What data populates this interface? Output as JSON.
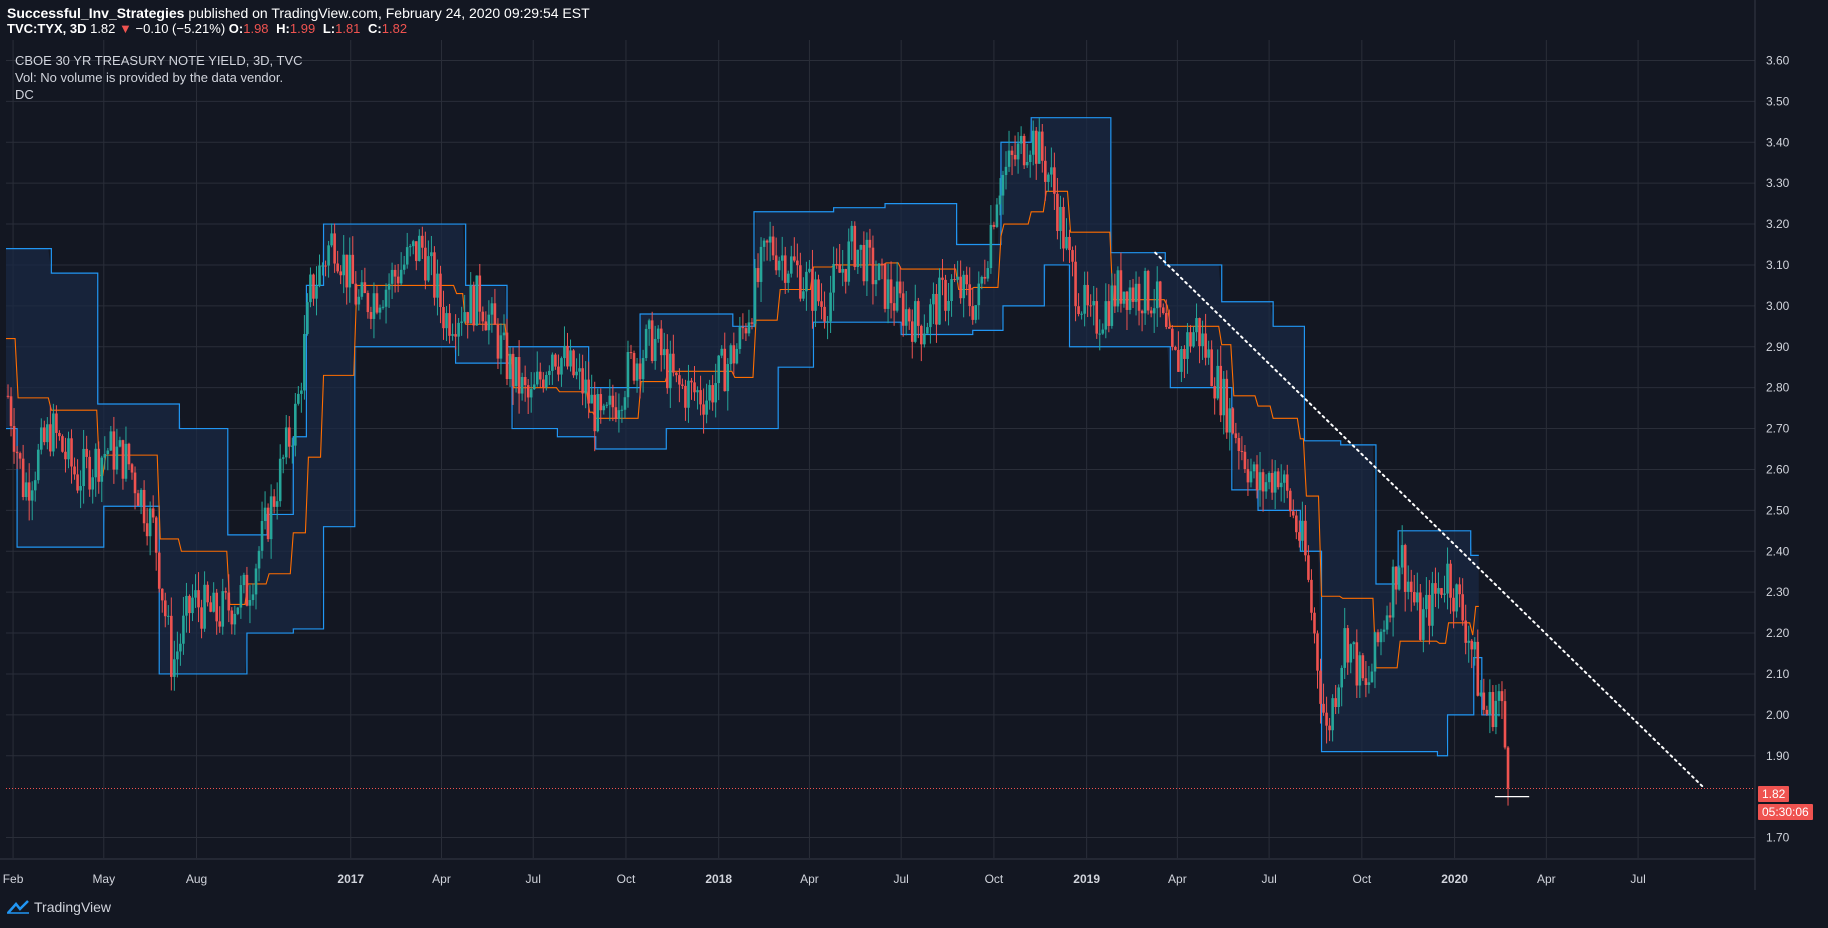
{
  "header": {
    "author": "Successful_Inv_Strategies",
    "published": "published on TradingView.com, February 24, 2020 09:29:54 EST"
  },
  "quote": {
    "symbol": "TVC:TYX, 3D",
    "last": "1.82",
    "arrow": "▼",
    "change": "−0.10 (−5.21%)",
    "o_label": "O:",
    "o": "1.98",
    "h_label": "H:",
    "h": "1.99",
    "l_label": "L:",
    "l": "1.81",
    "c_label": "C:",
    "c": "1.82"
  },
  "legend": {
    "title": "CBOE 30 YR TREASURY NOTE YIELD, 3D, TVC",
    "volume": "Vol: No volume is provided by the data vendor.",
    "indicator": "DC"
  },
  "price_tag": {
    "value": "1.82",
    "countdown": "05:30:06"
  },
  "branding": {
    "name": "TradingView"
  },
  "colors": {
    "background": "#131722",
    "grid": "#2a2e39",
    "up": "#26a69a",
    "down": "#ef5350",
    "channel": "#2196f3",
    "channel_fill": "#1a2a44",
    "basis": "#ff6d00",
    "trendline": "#ffffff"
  },
  "chart_data": {
    "type": "candlestick",
    "ylim": [
      1.65,
      3.65
    ],
    "yticks": [
      "3.60",
      "3.50",
      "3.40",
      "3.30",
      "3.20",
      "3.10",
      "3.00",
      "2.90",
      "2.80",
      "2.70",
      "2.60",
      "2.50",
      "2.40",
      "2.30",
      "2.20",
      "2.10",
      "2.00",
      "1.90",
      "1.70"
    ],
    "xlim": [
      "2016-01-25",
      "2020-10-25"
    ],
    "xticks": [
      {
        "date": "2016-02-01",
        "label": "Feb",
        "bold": false
      },
      {
        "date": "2016-05-01",
        "label": "May",
        "bold": false
      },
      {
        "date": "2016-08-01",
        "label": "Aug",
        "bold": false
      },
      {
        "date": "2017-01-01",
        "label": "2017",
        "bold": true
      },
      {
        "date": "2017-04-01",
        "label": "Apr",
        "bold": false
      },
      {
        "date": "2017-07-01",
        "label": "Jul",
        "bold": false
      },
      {
        "date": "2017-10-01",
        "label": "Oct",
        "bold": false
      },
      {
        "date": "2018-01-01",
        "label": "2018",
        "bold": true
      },
      {
        "date": "2018-04-01",
        "label": "Apr",
        "bold": false
      },
      {
        "date": "2018-07-01",
        "label": "Jul",
        "bold": false
      },
      {
        "date": "2018-10-01",
        "label": "Oct",
        "bold": false
      },
      {
        "date": "2019-01-01",
        "label": "2019",
        "bold": true
      },
      {
        "date": "2019-04-01",
        "label": "Apr",
        "bold": false
      },
      {
        "date": "2019-07-01",
        "label": "Jul",
        "bold": false
      },
      {
        "date": "2019-10-01",
        "label": "Oct",
        "bold": false
      },
      {
        "date": "2020-01-01",
        "label": "2020",
        "bold": true
      },
      {
        "date": "2020-04-01",
        "label": "Apr",
        "bold": false
      },
      {
        "date": "2020-07-01",
        "label": "Jul",
        "bold": false
      }
    ],
    "close_path": [
      [
        "2016-01-27",
        2.78
      ],
      [
        "2016-02-12",
        2.55
      ],
      [
        "2016-03-10",
        2.7
      ],
      [
        "2016-04-05",
        2.58
      ],
      [
        "2016-05-05",
        2.65
      ],
      [
        "2016-05-25",
        2.62
      ],
      [
        "2016-06-20",
        2.45
      ],
      [
        "2016-07-08",
        2.12
      ],
      [
        "2016-07-28",
        2.28
      ],
      [
        "2016-08-20",
        2.24
      ],
      [
        "2016-09-20",
        2.3
      ],
      [
        "2016-10-10",
        2.47
      ],
      [
        "2016-11-09",
        2.75
      ],
      [
        "2016-11-22",
        3.03
      ],
      [
        "2016-12-15",
        3.17
      ],
      [
        "2017-01-10",
        3.0
      ],
      [
        "2017-02-05",
        3.05
      ],
      [
        "2017-03-12",
        3.15
      ],
      [
        "2017-04-05",
        2.97
      ],
      [
        "2017-05-10",
        3.02
      ],
      [
        "2017-06-05",
        2.86
      ],
      [
        "2017-06-28",
        2.76
      ],
      [
        "2017-07-20",
        2.9
      ],
      [
        "2017-08-20",
        2.8
      ],
      [
        "2017-09-08",
        2.7
      ],
      [
        "2017-10-05",
        2.85
      ],
      [
        "2017-10-28",
        2.92
      ],
      [
        "2017-11-20",
        2.8
      ],
      [
        "2017-12-20",
        2.78
      ],
      [
        "2018-01-20",
        2.9
      ],
      [
        "2018-02-20",
        3.15
      ],
      [
        "2018-03-15",
        3.1
      ],
      [
        "2018-04-15",
        3.0
      ],
      [
        "2018-05-15",
        3.15
      ],
      [
        "2018-06-15",
        3.04
      ],
      [
        "2018-07-20",
        2.95
      ],
      [
        "2018-08-20",
        3.05
      ],
      [
        "2018-09-15",
        3.0
      ],
      [
        "2018-10-05",
        3.3
      ],
      [
        "2018-11-07",
        3.42
      ],
      [
        "2018-11-28",
        3.3
      ],
      [
        "2018-12-15",
        3.1
      ],
      [
        "2019-01-05",
        2.95
      ],
      [
        "2019-02-05",
        3.05
      ],
      [
        "2019-03-10",
        3.02
      ],
      [
        "2019-03-28",
        2.85
      ],
      [
        "2019-04-20",
        2.95
      ],
      [
        "2019-05-20",
        2.75
      ],
      [
        "2019-06-20",
        2.55
      ],
      [
        "2019-07-10",
        2.6
      ],
      [
        "2019-08-05",
        2.4
      ],
      [
        "2019-08-27",
        1.95
      ],
      [
        "2019-09-15",
        2.2
      ],
      [
        "2019-10-05",
        2.05
      ],
      [
        "2019-11-08",
        2.4
      ],
      [
        "2019-11-28",
        2.22
      ],
      [
        "2019-12-25",
        2.35
      ],
      [
        "2020-01-15",
        2.2
      ],
      [
        "2020-01-31",
        2.0
      ],
      [
        "2020-02-15",
        2.05
      ],
      [
        "2020-02-24",
        1.82
      ]
    ],
    "donchian_upper": [
      [
        "2016-01-25",
        3.14
      ],
      [
        "2016-03-10",
        3.08
      ],
      [
        "2016-04-25",
        2.76
      ],
      [
        "2016-07-15",
        2.7
      ],
      [
        "2016-09-01",
        2.44
      ],
      [
        "2016-10-10",
        2.49
      ],
      [
        "2016-11-05",
        2.68
      ],
      [
        "2016-11-18",
        3.05
      ],
      [
        "2016-12-05",
        3.2
      ],
      [
        "2017-04-25",
        3.05
      ],
      [
        "2017-06-05",
        2.9
      ],
      [
        "2017-08-25",
        2.8
      ],
      [
        "2017-10-15",
        2.98
      ],
      [
        "2018-01-15",
        2.95
      ],
      [
        "2018-02-05",
        3.23
      ],
      [
        "2018-04-25",
        3.24
      ],
      [
        "2018-06-15",
        3.25
      ],
      [
        "2018-08-25",
        3.15
      ],
      [
        "2018-10-08",
        3.4
      ],
      [
        "2018-11-07",
        3.46
      ],
      [
        "2019-01-25",
        3.13
      ],
      [
        "2019-03-20",
        3.1
      ],
      [
        "2019-05-15",
        3.01
      ],
      [
        "2019-07-05",
        2.95
      ],
      [
        "2019-08-05",
        2.67
      ],
      [
        "2019-09-10",
        2.66
      ],
      [
        "2019-10-15",
        2.32
      ],
      [
        "2019-11-06",
        2.45
      ],
      [
        "2020-01-10",
        2.45
      ],
      [
        "2020-01-17",
        2.39
      ],
      [
        "2020-01-25",
        2.39
      ]
    ],
    "donchian_lower": [
      [
        "2016-01-25",
        2.7
      ],
      [
        "2016-02-05",
        2.41
      ],
      [
        "2016-04-25",
        2.41
      ],
      [
        "2016-05-01",
        2.51
      ],
      [
        "2016-06-25",
        2.1
      ],
      [
        "2016-09-05",
        2.1
      ],
      [
        "2016-09-20",
        2.2
      ],
      [
        "2016-11-05",
        2.21
      ],
      [
        "2016-12-05",
        2.46
      ],
      [
        "2017-01-05",
        2.9
      ],
      [
        "2017-04-15",
        2.86
      ],
      [
        "2017-06-10",
        2.7
      ],
      [
        "2017-07-25",
        2.68
      ],
      [
        "2017-09-01",
        2.65
      ],
      [
        "2017-11-10",
        2.7
      ],
      [
        "2018-01-15",
        2.7
      ],
      [
        "2018-03-01",
        2.85
      ],
      [
        "2018-04-05",
        2.96
      ],
      [
        "2018-07-01",
        2.93
      ],
      [
        "2018-09-10",
        2.94
      ],
      [
        "2018-10-10",
        3.0
      ],
      [
        "2018-11-20",
        3.1
      ],
      [
        "2018-12-15",
        2.9
      ],
      [
        "2019-03-25",
        2.8
      ],
      [
        "2019-05-25",
        2.55
      ],
      [
        "2019-06-20",
        2.5
      ],
      [
        "2019-08-01",
        2.4
      ],
      [
        "2019-08-22",
        1.91
      ],
      [
        "2019-12-15",
        1.9
      ],
      [
        "2019-12-25",
        2.0
      ],
      [
        "2020-01-20",
        2.14
      ],
      [
        "2020-01-28",
        2.0
      ],
      [
        "2020-02-15",
        2.0
      ]
    ],
    "current_price": 1.82,
    "support_line": {
      "from": "2020-02-10",
      "to": "2020-03-15",
      "value": 1.8
    },
    "trendline": {
      "from": [
        "2019-03-10",
        3.13
      ],
      "to": [
        "2020-09-05",
        1.82
      ]
    }
  }
}
